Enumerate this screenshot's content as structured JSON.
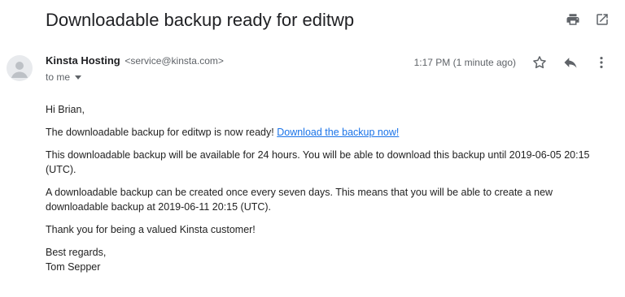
{
  "subject": "Downloadable backup ready for editwp",
  "top_actions": {
    "print_icon": "print-icon",
    "open_new_window_icon": "open-in-new-icon"
  },
  "sender": {
    "name": "Kinsta Hosting",
    "email": "<service@kinsta.com>",
    "recipient_label": "to me"
  },
  "message_meta": {
    "timestamp": "1:17 PM (1 minute ago)",
    "star_icon": "star-icon",
    "reply_icon": "reply-icon",
    "more_icon": "more-vert-icon"
  },
  "body": {
    "greeting": "Hi Brian,",
    "ready_text": "The downloadable backup for editwp is now ready!",
    "download_link": "Download the backup now!",
    "availability": "This downloadable backup will be available for 24 hours. You will be able to download this backup until 2019-06-05 20:15 (UTC).",
    "frequency": "A downloadable backup can be created once every seven days. This means that you will be able to create a new downloadable backup at 2019-06-11 20:15 (UTC).",
    "thanks": "Thank you for being a valued Kinsta customer!",
    "signoff": "Best regards,",
    "signature_name": "Tom Sepper"
  },
  "colors": {
    "link": "#1a73e8",
    "secondary_text": "#5f6368",
    "icon": "#5f6368"
  }
}
